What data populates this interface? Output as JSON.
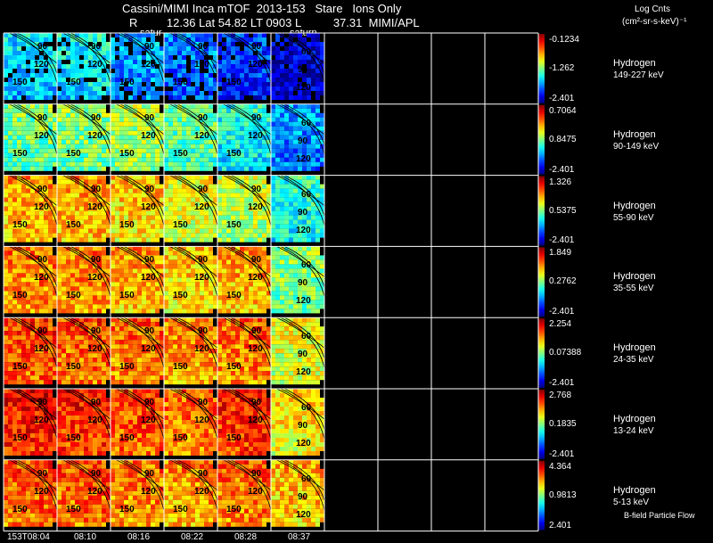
{
  "header": {
    "line1": "Cassini/MIMI Inca mTOF  2013-153   Stare   Ions Only",
    "line2": "R         12.36 Lat 54.82 LT 0903 L          37.31  MIMI/APL",
    "saturn_left": "satur",
    "saturn_right": "saturn",
    "log_label1": "Log Cnts",
    "log_label2": "(cm²-sr-s-keV)⁻¹"
  },
  "time_labels": [
    "153T08:04",
    "08:10",
    "08:16",
    "08:22",
    "08:28",
    "08:37"
  ],
  "contour_labels": [
    "90",
    "120",
    "150",
    "60"
  ],
  "footer": "B-field  Particle Flow",
  "rows": [
    {
      "species": "Hydrogen",
      "energy": "149-227 keV",
      "max": "-0.1234",
      "mid": "-1.262",
      "min": "-2.401",
      "levels": [
        0.35,
        0.38,
        0.3,
        0.25,
        0.18,
        0.1
      ]
    },
    {
      "species": "Hydrogen",
      "energy": "90-149 keV",
      "max": "0.7064",
      "mid": "0.8475",
      "min": "-2.401",
      "levels": [
        0.5,
        0.52,
        0.55,
        0.48,
        0.4,
        0.28
      ]
    },
    {
      "species": "Hydrogen",
      "energy": "55-90 keV",
      "max": "1.326",
      "mid": "0.5375",
      "min": "-2.401",
      "levels": [
        0.72,
        0.72,
        0.68,
        0.62,
        0.58,
        0.42
      ]
    },
    {
      "species": "Hydrogen",
      "energy": "35-55 keV",
      "max": "1.849",
      "mid": "0.2762",
      "min": "-2.401",
      "levels": [
        0.76,
        0.76,
        0.72,
        0.68,
        0.72,
        0.52
      ]
    },
    {
      "species": "Hydrogen",
      "energy": "24-35 keV",
      "max": "2.254",
      "mid": "0.07388",
      "min": "-2.401",
      "levels": [
        0.82,
        0.8,
        0.78,
        0.74,
        0.78,
        0.62
      ]
    },
    {
      "species": "Hydrogen",
      "energy": "13-24 keV",
      "max": "2.768",
      "mid": "0.1835",
      "min": "-2.401",
      "levels": [
        0.88,
        0.86,
        0.82,
        0.78,
        0.86,
        0.66
      ]
    },
    {
      "species": "Hydrogen",
      "energy": "5-13 keV",
      "max": "4.364",
      "mid": "0.9813",
      "min": "2.401",
      "levels": [
        0.8,
        0.8,
        0.76,
        0.74,
        0.78,
        0.7
      ]
    }
  ]
}
